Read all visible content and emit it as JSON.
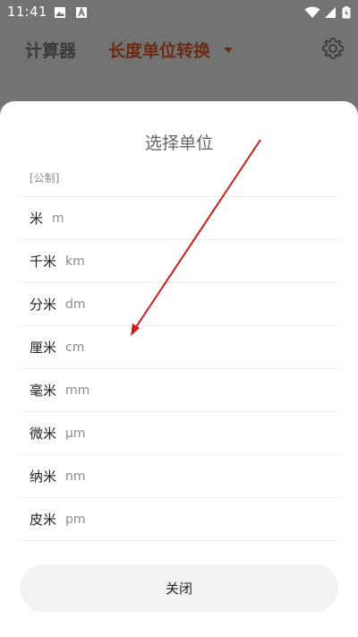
{
  "status_bar": {
    "time": "11:41",
    "icons": [
      "image-icon",
      "text-a-icon",
      "wifi-icon",
      "signal-icon",
      "battery-icon"
    ]
  },
  "app_bar": {
    "tab_calculator": "计算器",
    "tab_length": "长度单位转换",
    "settings_icon": "gear-icon"
  },
  "sheet": {
    "title": "选择单位",
    "section_label": "[公制]",
    "units": [
      {
        "name": "米",
        "symbol": "m"
      },
      {
        "name": "千米",
        "symbol": "km"
      },
      {
        "name": "分米",
        "symbol": "dm"
      },
      {
        "name": "厘米",
        "symbol": "cm"
      },
      {
        "name": "毫米",
        "symbol": "mm"
      },
      {
        "name": "微米",
        "symbol": "μm"
      },
      {
        "name": "纳米",
        "symbol": "nm"
      },
      {
        "name": "皮米",
        "symbol": "pm"
      }
    ],
    "close_label": "关闭"
  },
  "colors": {
    "overlay_background": "#737373",
    "sheet_background": "#ffffff",
    "active_tab": "#6b2b14",
    "annotation_arrow": "#d11a1a"
  }
}
